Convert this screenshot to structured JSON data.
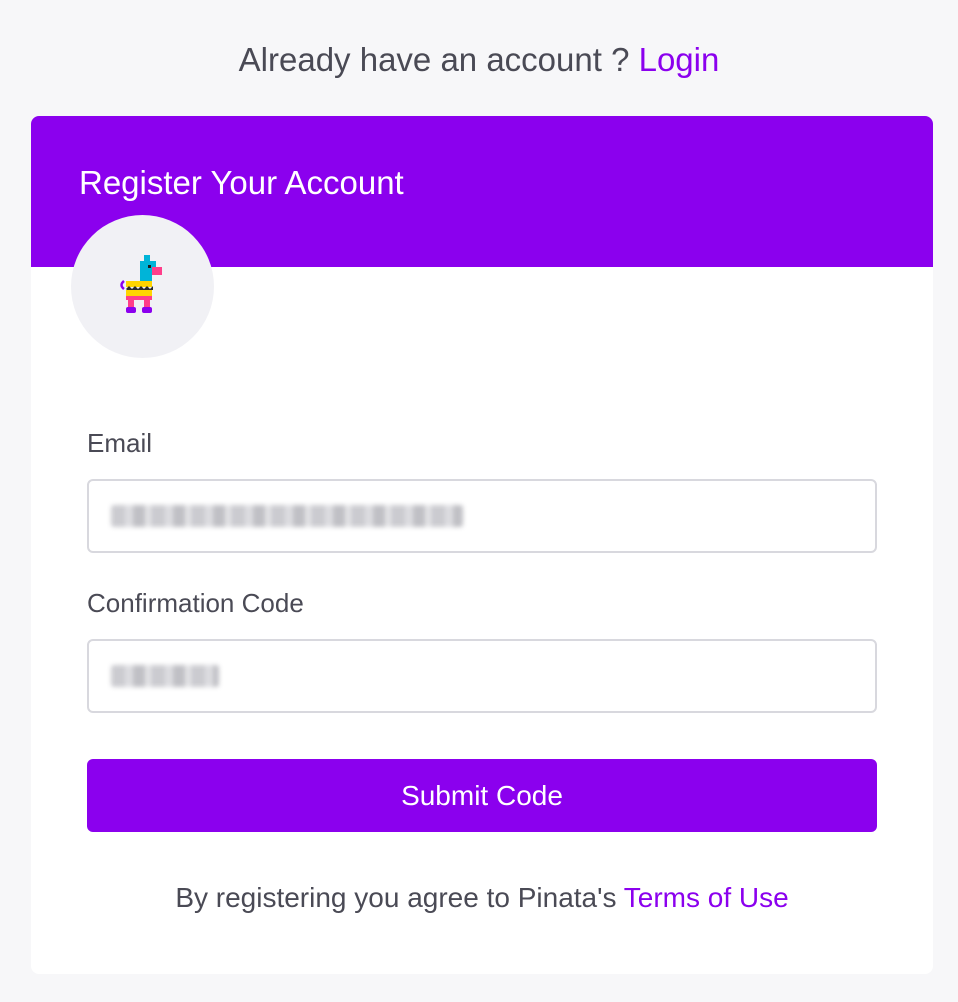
{
  "header": {
    "prompt_text": "Already have an account ?",
    "login_link": "Login"
  },
  "card": {
    "title": "Register Your Account",
    "logo_icon": "pinata-llama-icon"
  },
  "form": {
    "email": {
      "label": "Email",
      "value": "[redacted email]"
    },
    "confirmation_code": {
      "label": "Confirmation Code",
      "value": "[redacted code]"
    },
    "submit_label": "Submit Code"
  },
  "footer": {
    "terms_text": "By registering you agree to Pinata's",
    "terms_link": "Terms of Use"
  },
  "colors": {
    "accent": "#8b00ee",
    "background": "#f7f7f9",
    "text": "#4a4a55"
  }
}
